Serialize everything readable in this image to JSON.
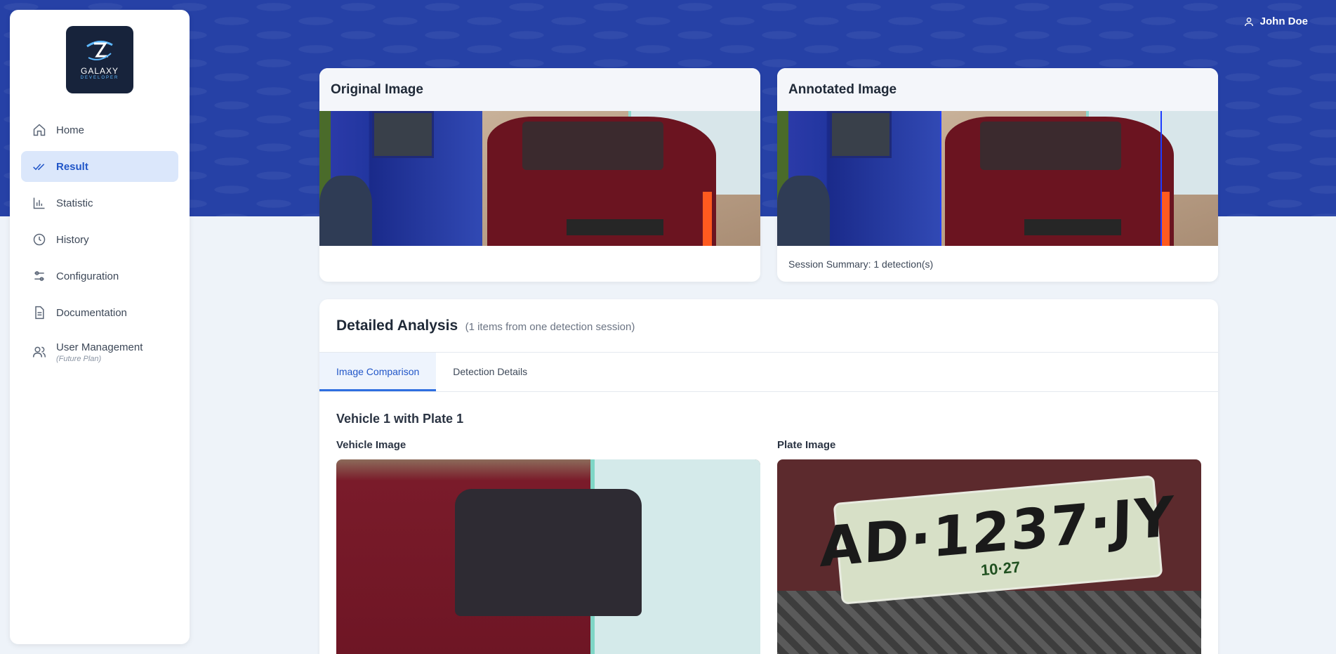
{
  "user": {
    "name": "John Doe",
    "icon": "user-icon"
  },
  "logo": {
    "line1": "GALAXY",
    "line2": "DEVELOPER"
  },
  "sidebar": {
    "items": [
      {
        "label": "Home",
        "icon": "home-icon"
      },
      {
        "label": "Result",
        "icon": "double-check-icon",
        "active": true
      },
      {
        "label": "Statistic",
        "icon": "bar-chart-icon"
      },
      {
        "label": "History",
        "icon": "clock-icon"
      },
      {
        "label": "Configuration",
        "icon": "sliders-icon"
      },
      {
        "label": "Documentation",
        "icon": "document-icon"
      },
      {
        "label": "User Management",
        "sublabel": "(Future Plan)",
        "icon": "users-icon"
      }
    ]
  },
  "original_card": {
    "title": "Original Image"
  },
  "annotated_card": {
    "title": "Annotated Image",
    "footer": "Session Summary: 1 detection(s)"
  },
  "analysis": {
    "title": "Detailed Analysis",
    "subtitle": "(1 items from one detection session)",
    "tabs": [
      {
        "label": "Image Comparison",
        "active": true
      },
      {
        "label": "Detection Details"
      }
    ],
    "vehicle_title": "Vehicle 1 with Plate 1",
    "vehicle_label": "Vehicle Image",
    "plate_label": "Plate Image",
    "plate_number": "AD·1237·JY",
    "plate_expiry": "10·27"
  },
  "colors": {
    "accent": "#2156c8",
    "hero": "#2641a6",
    "bbox": "#1e3dff"
  }
}
